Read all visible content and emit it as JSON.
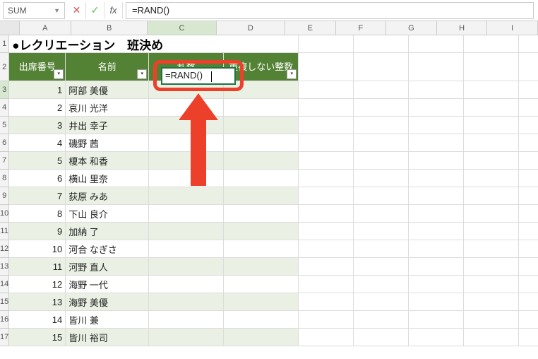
{
  "formula_bar": {
    "name_box": "SUM",
    "cancel": "✕",
    "confirm": "✓",
    "fx": "fx",
    "formula": "=RAND()"
  },
  "columns": [
    "A",
    "B",
    "C",
    "D",
    "E",
    "F",
    "G",
    "H",
    "I"
  ],
  "row_numbers": [
    1,
    2,
    3,
    4,
    5,
    6,
    7,
    8,
    9,
    10,
    11,
    12,
    13,
    14,
    15,
    16,
    17
  ],
  "title": "●レクリエーション　班決め",
  "headers": {
    "a": "出席番号",
    "b": "名前",
    "c": "乱数",
    "d": "重複しない整数"
  },
  "active_cell_value": "=RAND()",
  "rows": [
    {
      "n": "1",
      "name": "阿部 美優"
    },
    {
      "n": "2",
      "name": "哀川 光洋"
    },
    {
      "n": "3",
      "name": "井出 幸子"
    },
    {
      "n": "4",
      "name": "磯野 茜"
    },
    {
      "n": "5",
      "name": "榎本 和香"
    },
    {
      "n": "6",
      "name": "横山 里奈"
    },
    {
      "n": "7",
      "name": "荻原 みあ"
    },
    {
      "n": "8",
      "name": "下山 良介"
    },
    {
      "n": "9",
      "name": "加納 了"
    },
    {
      "n": "10",
      "name": "河合 なぎさ"
    },
    {
      "n": "11",
      "name": "河野 直人"
    },
    {
      "n": "12",
      "name": "海野 一代"
    },
    {
      "n": "13",
      "name": "海野 美優"
    },
    {
      "n": "14",
      "name": "皆川 兼"
    },
    {
      "n": "15",
      "name": "皆川 裕司"
    }
  ]
}
